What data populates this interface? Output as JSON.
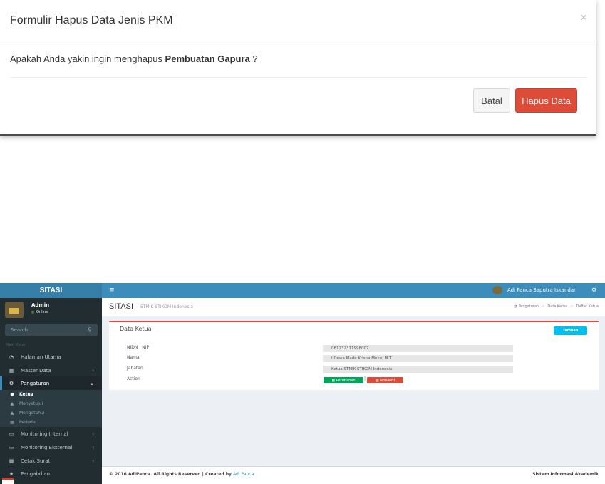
{
  "modal": {
    "title": "Formulir Hapus Data Jenis PKM",
    "close_glyph": "×",
    "question_prefix": "Apakah Anda yakin ingin menghapus ",
    "item_name": "Pembuatan Gapura",
    "question_suffix": " ?",
    "cancel_label": "Batal",
    "delete_label": "Hapus Data"
  },
  "app": {
    "logo": "SITASI",
    "user": {
      "name": "Admin",
      "status": "Online"
    },
    "search": {
      "placeholder": "Search..."
    },
    "menu_header": "Main Menu",
    "menu": [
      {
        "label": "Halaman Utama",
        "icon": "dashboard-icon"
      },
      {
        "label": "Master Data",
        "icon": "database-icon"
      },
      {
        "label": "Pengaturan",
        "icon": "gears-icon"
      },
      {
        "label": "Monitoring Internal",
        "icon": "monitor-icon"
      },
      {
        "label": "Monitoring Eksternal",
        "icon": "monitor-icon"
      },
      {
        "label": "Cetak Surat",
        "icon": "print-icon"
      },
      {
        "label": "Pengabdian",
        "icon": "star-icon"
      }
    ],
    "submenu": [
      {
        "label": "Ketua"
      },
      {
        "label": "Menyetujui"
      },
      {
        "label": "Mengetahui"
      },
      {
        "label": "Periode"
      }
    ],
    "topbar": {
      "user_name": "Adi Panca Saputra Iskandar"
    },
    "header": {
      "brand": "SITASI",
      "brand_sub": "STMIK STIKOM Indonesia",
      "crumbs": [
        "Pengaturan",
        "Data Ketua",
        "Daftar Ketua"
      ]
    },
    "box": {
      "title": "Data Ketua",
      "add_label": "Tambah",
      "rows": [
        {
          "label": "NIDN | NIP",
          "value": "081232311998007"
        },
        {
          "label": "Nama",
          "value": "I Dewa Made Krisna Muku, M.T"
        },
        {
          "label": "Jabatan",
          "value": "Ketua STMIK STIKOM Indonesia"
        },
        {
          "label": "Action",
          "value": ""
        }
      ],
      "edit_label": "Perubahan",
      "deactivate_label": "Nonaktif"
    },
    "footer": {
      "left": "© 2016 AdiPanca. All Rights Reserved | Created by ",
      "author": "Adi Panca",
      "right": "Sistem Informasi Akademik"
    }
  }
}
